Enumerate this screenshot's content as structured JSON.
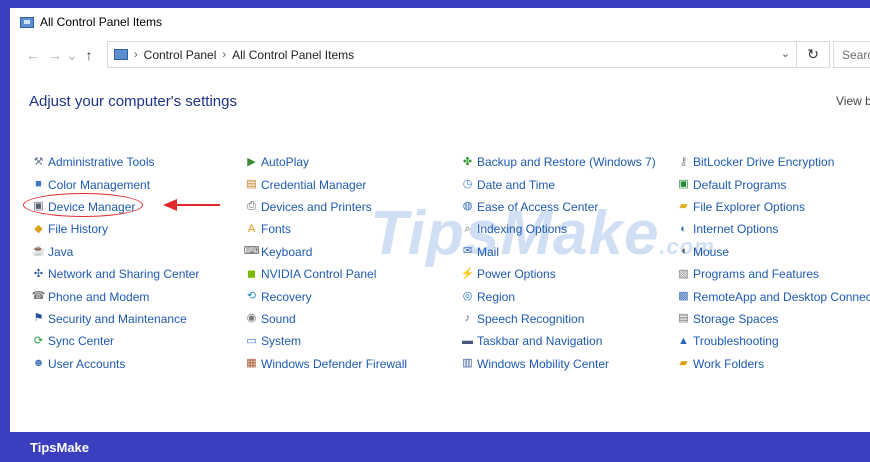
{
  "window": {
    "title": "All Control Panel Items",
    "title_icon": "control-panel-icon"
  },
  "nav": {
    "back": "←",
    "forward": "→",
    "up": "↑",
    "breadcrumb": [
      "Control Panel",
      "All Control Panel Items"
    ],
    "separator": "›",
    "dropdown": "⌄",
    "refresh": "↻",
    "search_placeholder": "Searc"
  },
  "main": {
    "heading": "Adjust your computer's settings",
    "view_by_label": "View by"
  },
  "items": {
    "col0": [
      {
        "label": "Administrative Tools",
        "icon": "admin-tools-icon",
        "glyph": "⚒",
        "color": "#6b7a8a"
      },
      {
        "label": "Color Management",
        "icon": "color-management-icon",
        "glyph": "■",
        "color": "#3a78c8"
      },
      {
        "label": "Device Manager",
        "icon": "device-manager-icon",
        "glyph": "▣",
        "color": "#5a6470"
      },
      {
        "label": "File History",
        "icon": "file-history-icon",
        "glyph": "◆",
        "color": "#e0a11a"
      },
      {
        "label": "Java",
        "icon": "java-icon",
        "glyph": "☕",
        "color": "#d1461f"
      },
      {
        "label": "Network and Sharing Center",
        "icon": "network-icon",
        "glyph": "✣",
        "color": "#2a5a9a"
      },
      {
        "label": "Phone and Modem",
        "icon": "phone-modem-icon",
        "glyph": "☎",
        "color": "#7a7a7a"
      },
      {
        "label": "Security and Maintenance",
        "icon": "security-flag-icon",
        "glyph": "⚑",
        "color": "#2a4f9a"
      },
      {
        "label": "Sync Center",
        "icon": "sync-center-icon",
        "glyph": "⟳",
        "color": "#1f9a3a"
      },
      {
        "label": "User Accounts",
        "icon": "user-accounts-icon",
        "glyph": "☻",
        "color": "#4a7ab8"
      }
    ],
    "col1": [
      {
        "label": "AutoPlay",
        "icon": "autoplay-icon",
        "glyph": "▶",
        "color": "#3a8a3a"
      },
      {
        "label": "Credential Manager",
        "icon": "credential-manager-icon",
        "glyph": "▤",
        "color": "#c07a1a"
      },
      {
        "label": "Devices and Printers",
        "icon": "printer-icon",
        "glyph": "⎙",
        "color": "#5a5a5a"
      },
      {
        "label": "Fonts",
        "icon": "fonts-icon",
        "glyph": "A",
        "color": "#d0a010"
      },
      {
        "label": "Keyboard",
        "icon": "keyboard-icon",
        "glyph": "⌨",
        "color": "#5a5a5a"
      },
      {
        "label": "NVIDIA Control Panel",
        "icon": "nvidia-icon",
        "glyph": "◼",
        "color": "#76b900"
      },
      {
        "label": "Recovery",
        "icon": "recovery-icon",
        "glyph": "⟲",
        "color": "#2a8ac8"
      },
      {
        "label": "Sound",
        "icon": "sound-icon",
        "glyph": "◉",
        "color": "#7a7a7a"
      },
      {
        "label": "System",
        "icon": "system-icon",
        "glyph": "▭",
        "color": "#3a78c8"
      },
      {
        "label": "Windows Defender Firewall",
        "icon": "firewall-icon",
        "glyph": "▦",
        "color": "#a0522d"
      }
    ],
    "col2": [
      {
        "label": "Backup and Restore (Windows 7)",
        "icon": "backup-restore-icon",
        "glyph": "✤",
        "color": "#3a9a3a"
      },
      {
        "label": "Date and Time",
        "icon": "date-time-icon",
        "glyph": "◷",
        "color": "#3a78c8"
      },
      {
        "label": "Ease of Access Center",
        "icon": "ease-of-access-icon",
        "glyph": "◍",
        "color": "#2a6ab8"
      },
      {
        "label": "Indexing Options",
        "icon": "indexing-options-icon",
        "glyph": "⌕",
        "color": "#6a6a6a"
      },
      {
        "label": "Mail",
        "icon": "mail-icon",
        "glyph": "✉",
        "color": "#2a6ab8"
      },
      {
        "label": "Power Options",
        "icon": "power-options-icon",
        "glyph": "⚡",
        "color": "#3a9a3a"
      },
      {
        "label": "Region",
        "icon": "region-icon",
        "glyph": "◎",
        "color": "#2a7ac8"
      },
      {
        "label": "Speech Recognition",
        "icon": "microphone-icon",
        "glyph": "♪",
        "color": "#6a6a6a"
      },
      {
        "label": "Taskbar and Navigation",
        "icon": "taskbar-icon",
        "glyph": "▬",
        "color": "#4a5a7a"
      },
      {
        "label": "Windows Mobility Center",
        "icon": "mobility-center-icon",
        "glyph": "▥",
        "color": "#3a5a9a"
      }
    ],
    "col3": [
      {
        "label": "BitLocker Drive Encryption",
        "icon": "bitlocker-key-icon",
        "glyph": "⚷",
        "color": "#8a8a8a"
      },
      {
        "label": "Default Programs",
        "icon": "default-programs-icon",
        "glyph": "▣",
        "color": "#2a8a3a"
      },
      {
        "label": "File Explorer Options",
        "icon": "folder-options-icon",
        "glyph": "▰",
        "color": "#e0b020"
      },
      {
        "label": "Internet Options",
        "icon": "internet-options-icon",
        "glyph": "◐",
        "color": "#2a7ac8"
      },
      {
        "label": "Mouse",
        "icon": "mouse-icon",
        "glyph": "◖",
        "color": "#5a5a5a"
      },
      {
        "label": "Programs and Features",
        "icon": "programs-features-icon",
        "glyph": "▧",
        "color": "#7a7a7a"
      },
      {
        "label": "RemoteApp and Desktop Connections",
        "icon": "remoteapp-icon",
        "glyph": "▩",
        "color": "#3a6ab8"
      },
      {
        "label": "Storage Spaces",
        "icon": "storage-spaces-icon",
        "glyph": "▤",
        "color": "#6a6a6a"
      },
      {
        "label": "Troubleshooting",
        "icon": "troubleshooting-icon",
        "glyph": "▲",
        "color": "#2a6ab8"
      },
      {
        "label": "Work Folders",
        "icon": "work-folders-icon",
        "glyph": "▰",
        "color": "#e0a010"
      }
    ]
  },
  "annotation": {
    "highlight_target": "Device Manager",
    "arrow_color": "#e02a2a"
  },
  "watermark": {
    "text": "TipsMake",
    "suffix": ".com"
  },
  "footer": {
    "brand": "TipsMake"
  },
  "colors": {
    "frame": "#3b3fbf",
    "link": "#1e5ab0",
    "heading": "#1e3287"
  }
}
